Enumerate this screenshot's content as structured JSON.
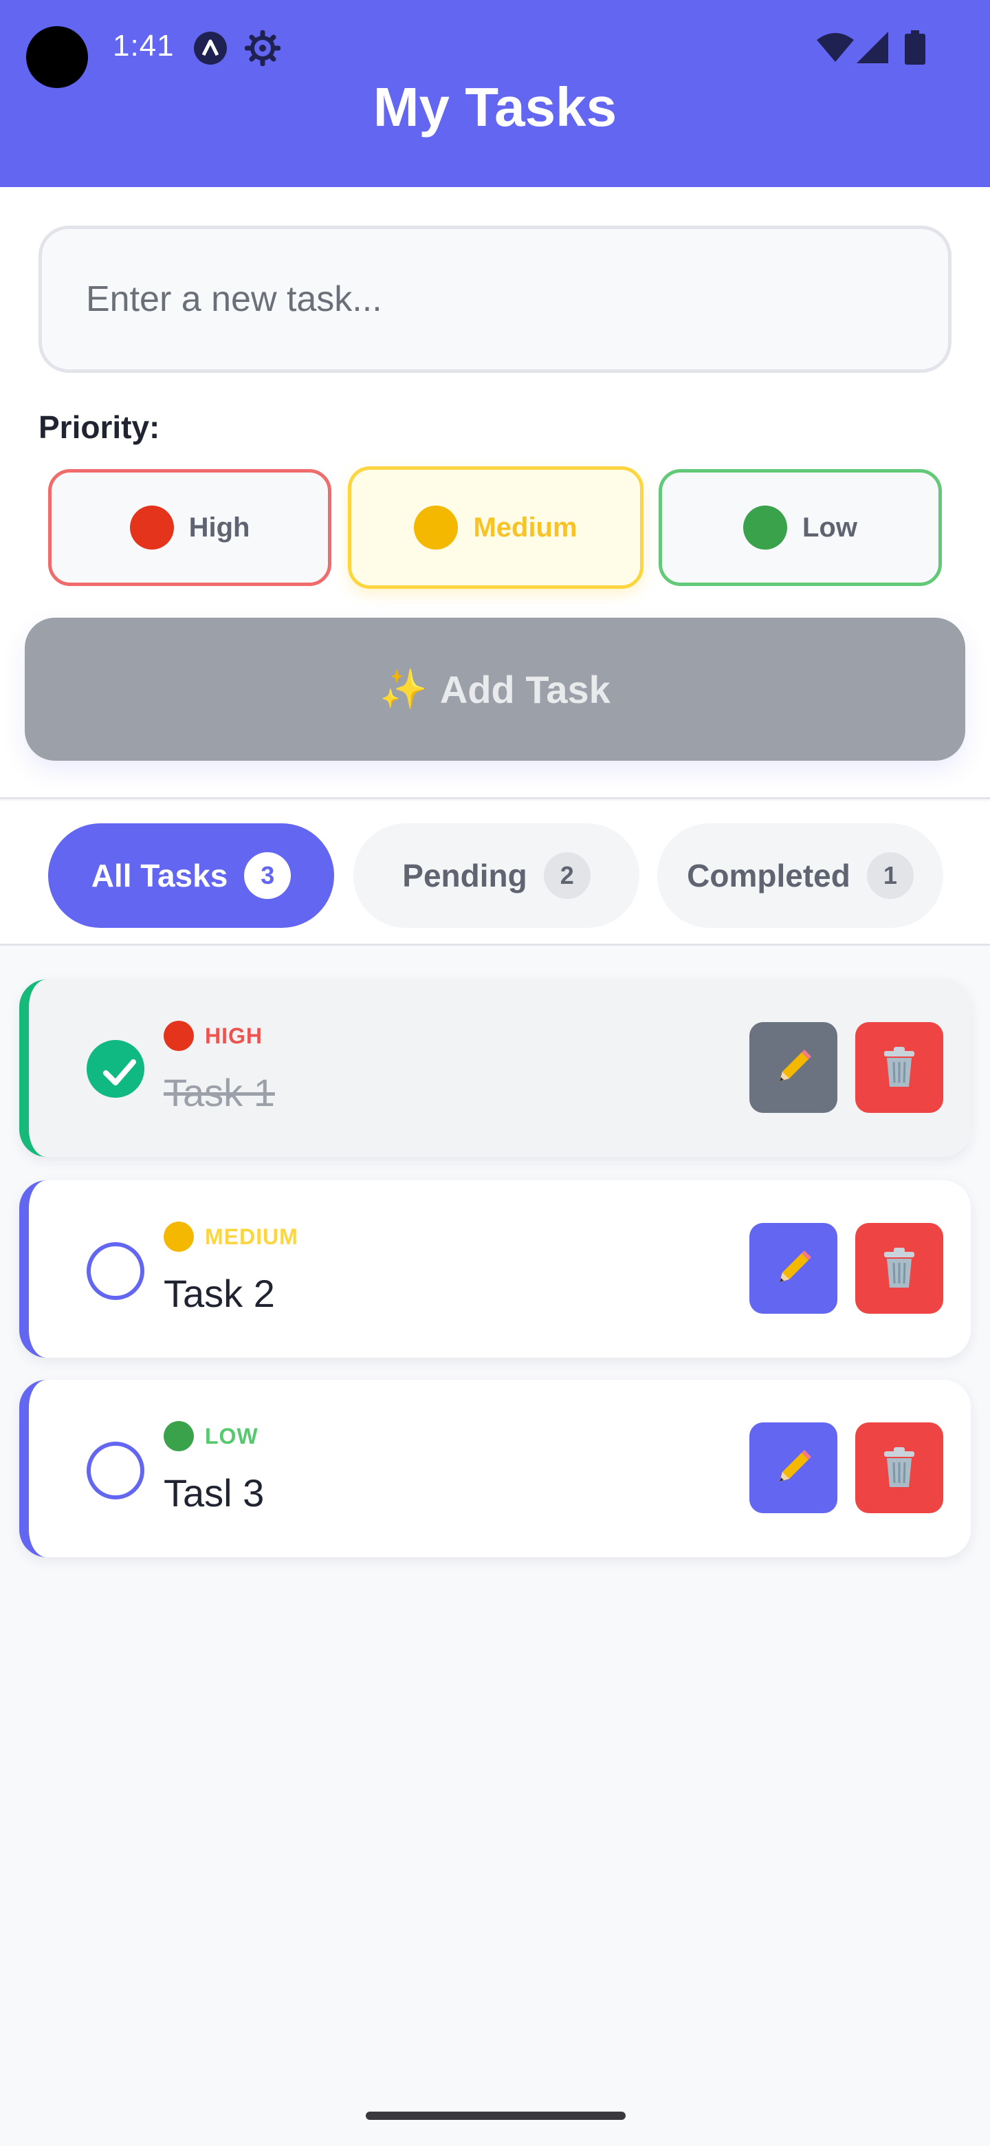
{
  "status_bar": {
    "time": "1:41",
    "icons": [
      "camera-cutout",
      "a-icon",
      "gear-icon",
      "wifi-icon",
      "signal-icon",
      "battery-icon"
    ]
  },
  "header": {
    "title": "My Tasks",
    "background": "#6366f1"
  },
  "new_task": {
    "placeholder": "Enter a new task...",
    "value": ""
  },
  "priority": {
    "label": "Priority:",
    "options": [
      {
        "label": "High",
        "icon": "red-circle-icon",
        "color": "#e4341c",
        "selected": false
      },
      {
        "label": "Medium",
        "icon": "yellow-circle-icon",
        "color": "#f5b800",
        "selected": true
      },
      {
        "label": "Low",
        "icon": "green-circle-icon",
        "color": "#3aa24b",
        "selected": false
      }
    ]
  },
  "add_button": {
    "label": "Add Task",
    "icon": "sparkles-icon",
    "enabled": false
  },
  "filters": [
    {
      "label": "All Tasks",
      "count": "3",
      "active": true
    },
    {
      "label": "Pending",
      "count": "2",
      "active": false
    },
    {
      "label": "Completed",
      "count": "1",
      "active": false
    }
  ],
  "tasks": [
    {
      "priority": "HIGH",
      "priority_color": "#ef5350",
      "text": "Task 1",
      "completed": true,
      "edit_icon": "pencil-icon",
      "delete_icon": "trash-icon"
    },
    {
      "priority": "MEDIUM",
      "priority_color": "#fcd53f",
      "text": "Task 2",
      "completed": false,
      "edit_icon": "pencil-icon",
      "delete_icon": "trash-icon"
    },
    {
      "priority": "LOW",
      "priority_color": "#55c96e",
      "text": "Tasl 3",
      "completed": false,
      "edit_icon": "pencil-icon",
      "delete_icon": "trash-icon"
    }
  ],
  "colors": {
    "accent": "#6366f1",
    "success": "#10b981",
    "danger": "#ef4444",
    "muted_button": "#9ca0a9"
  }
}
